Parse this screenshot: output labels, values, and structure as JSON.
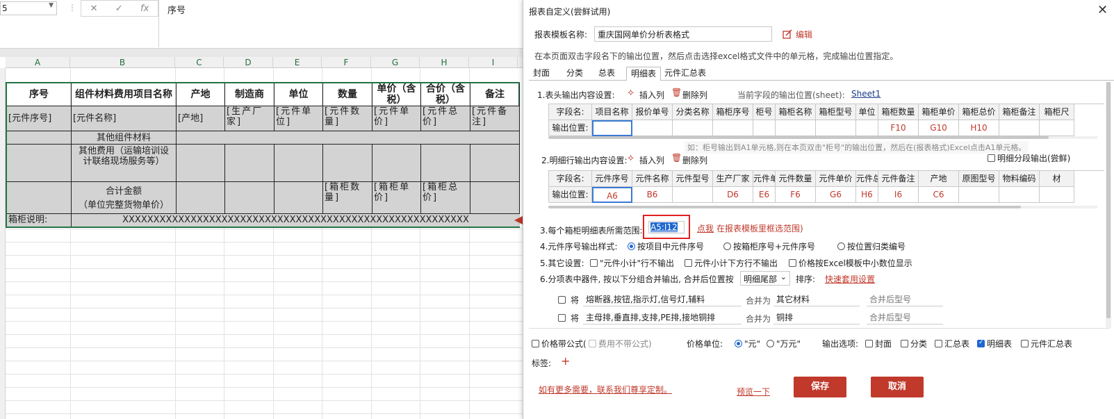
{
  "excel": {
    "name_box": "5",
    "formula_value": "序号",
    "fx_cancel": "✕",
    "fx_enter": "✓",
    "fx_label": "fx",
    "columns": [
      "A",
      "B",
      "C",
      "D",
      "E",
      "F",
      "G",
      "H",
      "I"
    ],
    "table": {
      "headers": [
        "序号",
        "组件材料费用项目名称",
        "产地",
        "制造商",
        "单位",
        "数量",
        "单价（含税）",
        "合价（含税）",
        "备注"
      ],
      "row1": [
        "[元件序号]",
        "[元件名称]",
        "[产地]",
        "[生产厂家]",
        "[元件单位]",
        "[元件数量]",
        "[元件单价]",
        "[元件总价]",
        "[元件备注]"
      ],
      "other_material": "其他组件材料",
      "other_fee": "其他费用（运输培训设计联络现场服务等）",
      "total": "合计金额",
      "total_note": "（单位完整货物单价）",
      "total_qty": "[箱柜数量]",
      "total_price": "[箱柜单价]",
      "total_sum": "[箱柜总价]",
      "cabinet_label": "箱柜说明:",
      "cabinet_value": "XXXXXXXXXXXXXXXXXXXXXXXXXXXXXXXXXXXXXXXXXXXXXXXXXXXXXXXX"
    }
  },
  "dialog": {
    "title": "报表自定义(尝鲜试用)",
    "template_label": "报表模板名称:",
    "template_value": "重庆国网单价分析表格式",
    "edit_label": "编辑",
    "instruction": "在本页面双击字段名下的输出位置，然后点击选择excel格式文件中的单元格，完成输出位置指定。",
    "tabs": [
      "封面",
      "分类",
      "总表",
      "明细表",
      "元件汇总表"
    ],
    "active_tab": "明细表",
    "sec1_label": "1.表头输出内容设置:",
    "insert_col": "插入列",
    "delete_col": "删除列",
    "current_pos_label": "当前字段的输出位置(sheet):",
    "current_pos_value": "Sheet1",
    "field_name_label": "字段名:",
    "output_pos_label": "输出位置:",
    "header_fields": [
      "项目名称",
      "报价单号",
      "分类名称",
      "箱柜序号",
      "柜号",
      "箱柜名称",
      "箱柜型号",
      "单位",
      "箱柜数量",
      "箱柜单价",
      "箱柜总价",
      "箱柜备注",
      "箱柜尺"
    ],
    "header_positions": [
      "",
      "",
      "",
      "",
      "",
      "",
      "",
      "",
      "F10",
      "G10",
      "H10",
      "",
      ""
    ],
    "hint": "如：柜号输出到A1单元格,则在本页双击\"柜号\"的输出位置，然后在(报表格式)Excel点击A1单元格。",
    "sec2_label": "2.明细行输出内容设置:",
    "detail_split": "明细分段输出(尝鲜)",
    "detail_fields": [
      "元件序号",
      "元件名称",
      "元件型号",
      "生产厂家",
      "元件单位",
      "元件数量",
      "元件单价",
      "元件总价",
      "元件备注",
      "产地",
      "原图型号",
      "物料编码",
      "材"
    ],
    "detail_positions": [
      "A6",
      "B6",
      "",
      "D6",
      "E6",
      "F6",
      "G6",
      "H6",
      "I6",
      "C6",
      "",
      "",
      ""
    ],
    "sec3_label": "3.每个箱柜明细表所需范围:",
    "range_value": "A5:I12",
    "click_me": "点我",
    "range_hint": "在报表模板里框选范围)",
    "sec4_label": "4.元件序号输出样式:",
    "sec4_opts": [
      "按项目中元件序号",
      "按箱柜序号+元件序号",
      "按位置归类编号"
    ],
    "sec5_label": "5.其它设置:",
    "sec5_opts": [
      "\"元件小计\"行不输出",
      "元件小计下方行不输出",
      "价格按Excel模板中小数位显示"
    ],
    "sec6_label": "6.分项表中器件, 按以下分组合并输出, 合并后位置按",
    "sec6_select": "明细尾部",
    "sort_label": "排序:",
    "quick_set": "快速套用设置",
    "merge_rows": [
      {
        "prefix": "将",
        "items": "熔断器,按钮,指示灯,信号灯,辅料",
        "merge_as": "合并为",
        "target": "其它材料",
        "model": "合并后型号"
      },
      {
        "prefix": "将",
        "items": "主母排,垂直排,支排,PE排,接地铜排",
        "merge_as": "合并为",
        "target": "铜排",
        "model": "合并后型号"
      }
    ],
    "price_formula": "价格带公式(",
    "fee_no_formula": "费用不带公式)",
    "price_unit_label": "价格单位:",
    "unit_yuan": "\"元\"",
    "unit_wan": "\"万元\"",
    "output_opts_label": "输出选项:",
    "output_opts": [
      "封面",
      "分类",
      "汇总表",
      "明细表",
      "元件汇总表"
    ],
    "tag_label": "标签:",
    "tag_add": "+",
    "contact": "如有更多需要，联系我们尊享定制。",
    "preview": "预览一下",
    "save": "保存",
    "cancel": "取消",
    "close": "✕"
  },
  "colors": {
    "accent_red": "#c0392b",
    "excel_green": "#217346",
    "select_blue": "#1e66d0"
  }
}
